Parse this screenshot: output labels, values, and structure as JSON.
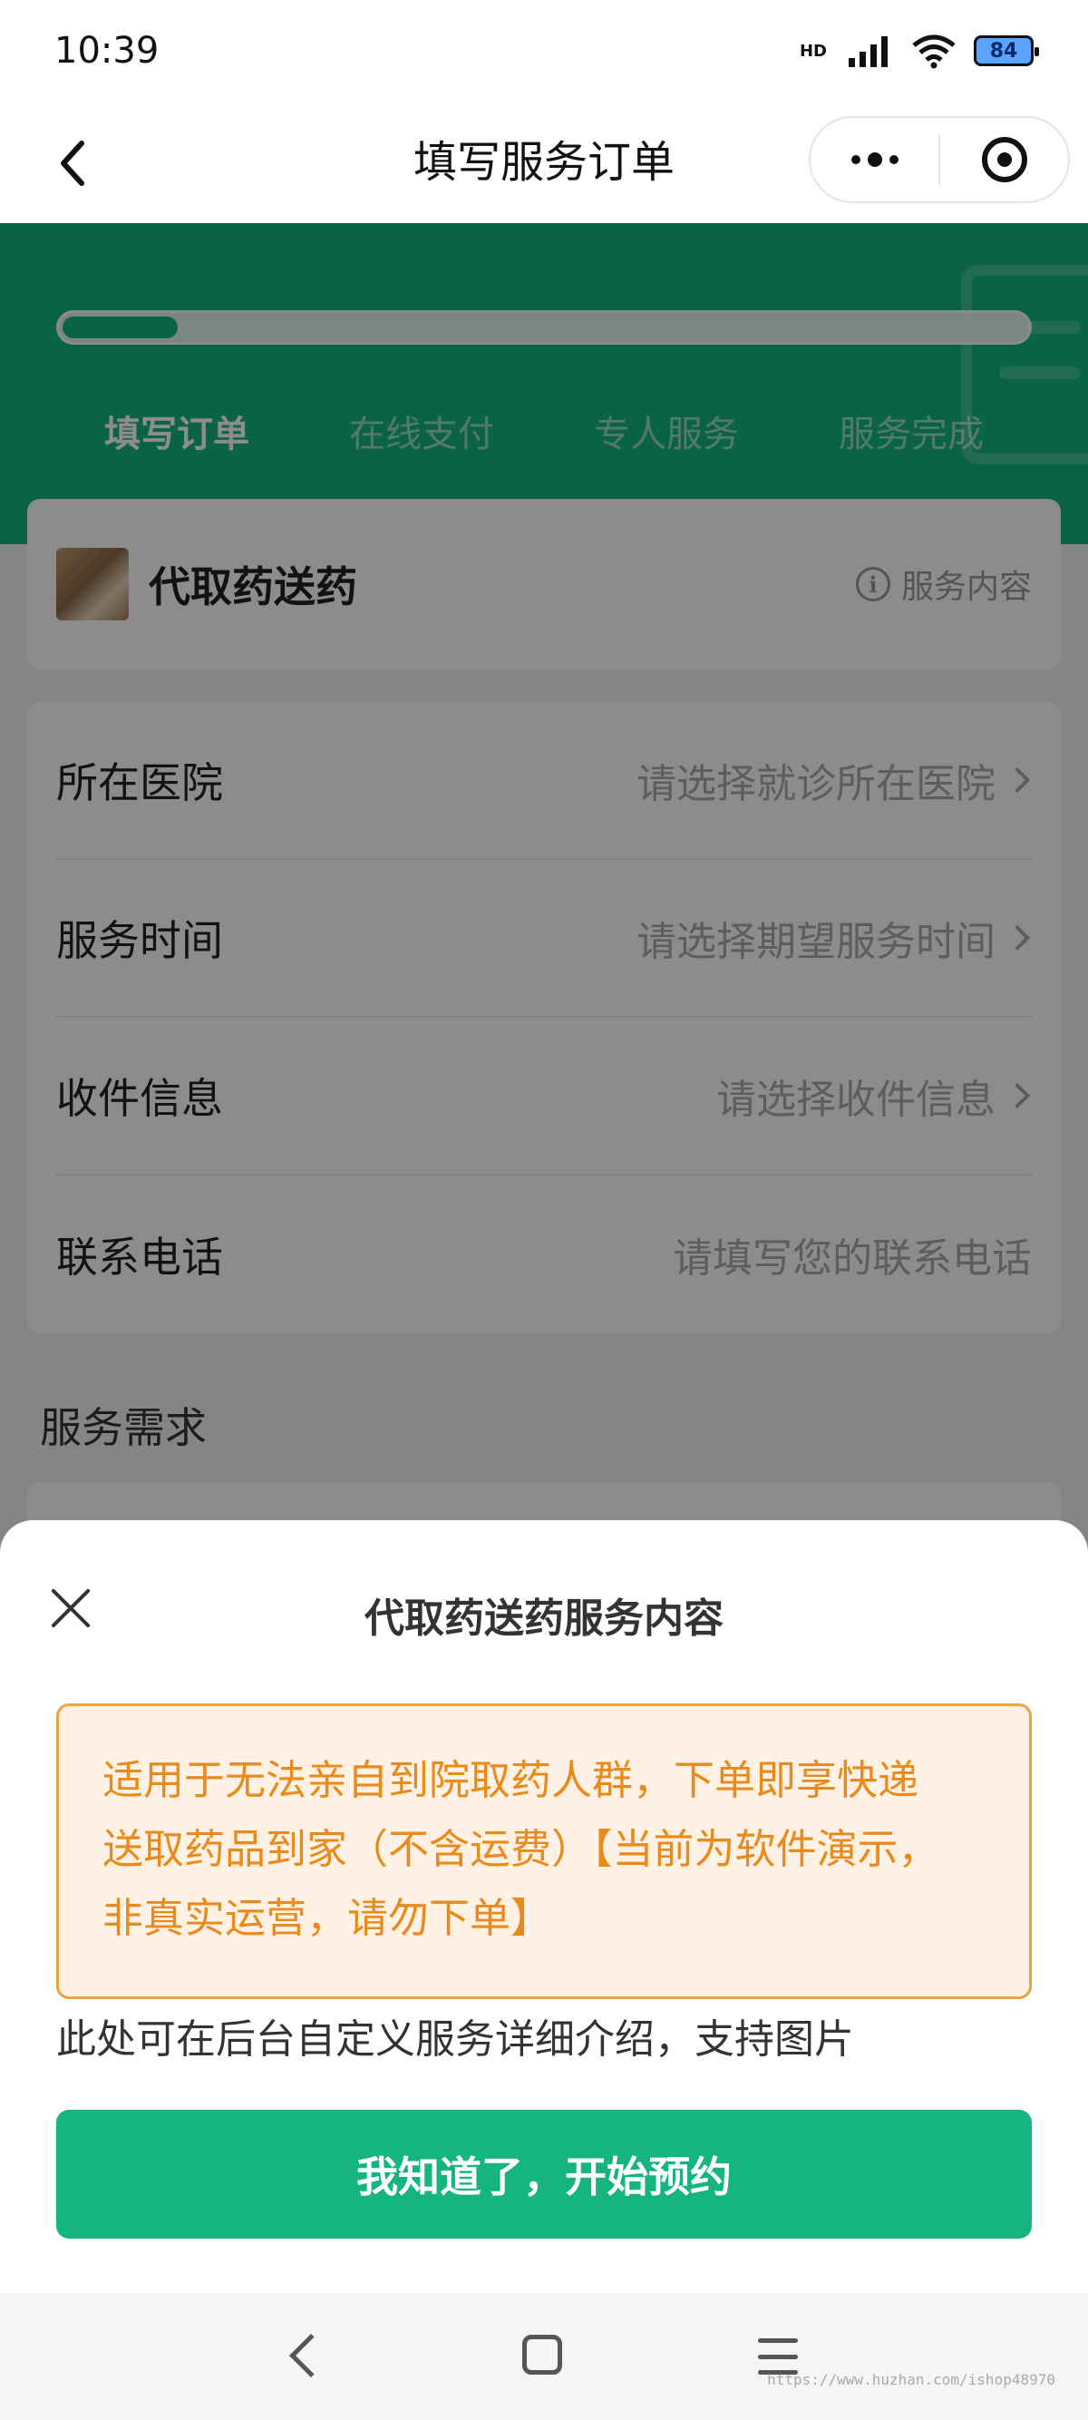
{
  "status_bar": {
    "time": "10:39",
    "network_badge": "HD",
    "battery": "84"
  },
  "nav": {
    "title": "填写服务订单",
    "icons": {
      "back": "back-chevron-icon",
      "more": "more-dots-icon",
      "close": "target-circle-icon"
    }
  },
  "progress": {
    "fraction": 0.12,
    "steps": [
      "填写订单",
      "在线支付",
      "专人服务",
      "服务完成"
    ],
    "active_step": 0
  },
  "service": {
    "name": "代取药送药",
    "info_label": "服务内容"
  },
  "form": {
    "rows": [
      {
        "label": "所在医院",
        "placeholder": "请选择就诊所在医院",
        "chevron": true
      },
      {
        "label": "服务时间",
        "placeholder": "请选择期望服务时间",
        "chevron": true
      },
      {
        "label": "收件信息",
        "placeholder": "请选择收件信息",
        "chevron": true
      },
      {
        "label": "联系电话",
        "placeholder": "请填写您的联系电话",
        "chevron": false
      }
    ]
  },
  "needs_section": {
    "title": "服务需求"
  },
  "sheet": {
    "title": "代取药送药服务内容",
    "notice_lines": [
      "适用于无法亲自到院取药人群，下单即享快递",
      "送取药品到家（不含运费）【当前为软件演示，",
      "非真实运营，请勿下单】"
    ],
    "description": "此处可在后台自定义服务详细介绍，支持图片",
    "button_label": "我知道了，开始预约"
  },
  "watermark": "https://www.huzhan.com/ishop48970",
  "colors": {
    "brand_green": "#14b47e",
    "notice_text": "#ea8a1d",
    "notice_border": "#e7a640",
    "notice_bg": "#fff1e3"
  }
}
